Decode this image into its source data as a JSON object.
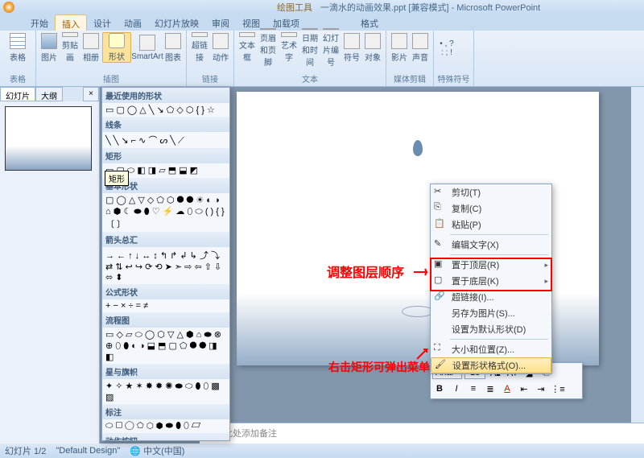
{
  "title_tool": "绘图工具",
  "title_doc": "一滴水的动画效果.ppt [兼容模式] - Microsoft PowerPoint",
  "menu": {
    "home": "开始",
    "insert": "插入",
    "design": "设计",
    "anim": "动画",
    "slideshow": "幻灯片放映",
    "review": "审阅",
    "view": "视图",
    "addins": "加载项",
    "format": "格式"
  },
  "ribbon": {
    "g1": {
      "name": "表格",
      "items": [
        "表格"
      ]
    },
    "g2": {
      "name": "插图",
      "items": [
        "图片",
        "剪贴画",
        "相册",
        "形状",
        "SmartArt",
        "图表"
      ]
    },
    "g3": {
      "name": "链接",
      "items": [
        "超链接",
        "动作"
      ]
    },
    "g4": {
      "name": "文本",
      "items": [
        "文本框",
        "页眉和页脚",
        "艺术字",
        "日期和时间",
        "幻灯片编号",
        "符号",
        "对象"
      ]
    },
    "g5": {
      "name": "媒体剪辑",
      "items": [
        "影片",
        "声音"
      ]
    },
    "g6": {
      "name": "特殊符号",
      "items": [
        ""
      ]
    }
  },
  "lp": {
    "tab1": "幻灯片",
    "tab2": "大纲"
  },
  "shapes": {
    "recent": "最近使用的形状",
    "lines": "线条",
    "rect": "矩形",
    "rect_tt": "矩形",
    "basic": "基本形状",
    "arrows": "箭头总汇",
    "formula": "公式形状",
    "flow": "流程图",
    "stars": "星与旗帜",
    "callout": "标注",
    "action": "动作按钮"
  },
  "ctx": {
    "cut": "剪切(T)",
    "copy": "复制(C)",
    "paste": "粘贴(P)",
    "edit": "编辑文字(X)",
    "front": "置于顶层(R)",
    "back": "置于底层(K)",
    "link": "超链接(I)...",
    "savepic": "另存为图片(S)...",
    "default": "设置为默认形状(D)",
    "size": "大小和位置(Z)...",
    "format": "设置形状格式(O)..."
  },
  "mini": {
    "font": "Arial",
    "size": "18"
  },
  "notes": "单击此处添加备注",
  "status": {
    "slide": "幻灯片 1/2",
    "theme": "\"Default Design\"",
    "lang": "中文(中国)"
  },
  "ann": {
    "text1": "调整图层顺序",
    "text2": "右击矩形可弹出菜单"
  }
}
